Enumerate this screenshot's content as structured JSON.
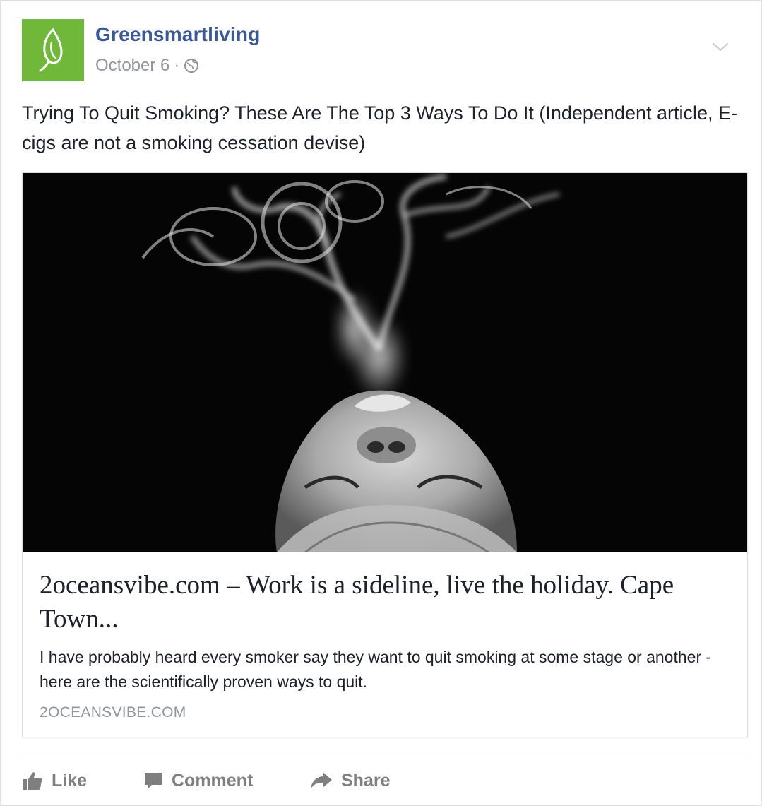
{
  "post": {
    "page_name": "Greensmartliving",
    "date": "October 6",
    "separator": "·",
    "audience_icon": "globe-icon",
    "text": "Trying To Quit Smoking? These Are The Top 3 Ways To Do It (Independent article, E-cigs are not a smoking cessation devise)"
  },
  "link_preview": {
    "title": "2oceansvibe.com – Work is a sideline, live the holiday. Cape Town...",
    "description": "I have probably heard every smoker say they want to quit smoking at some stage or another - here are the scientifically proven ways to quit.",
    "domain": "2OCEANSVIBE.COM"
  },
  "actions": {
    "like_label": "Like",
    "comment_label": "Comment",
    "share_label": "Share"
  },
  "colors": {
    "brand_blue": "#3b5998",
    "avatar_green": "#6fb83a",
    "meta_gray": "#90949c",
    "action_gray": "#7f7f7f"
  }
}
